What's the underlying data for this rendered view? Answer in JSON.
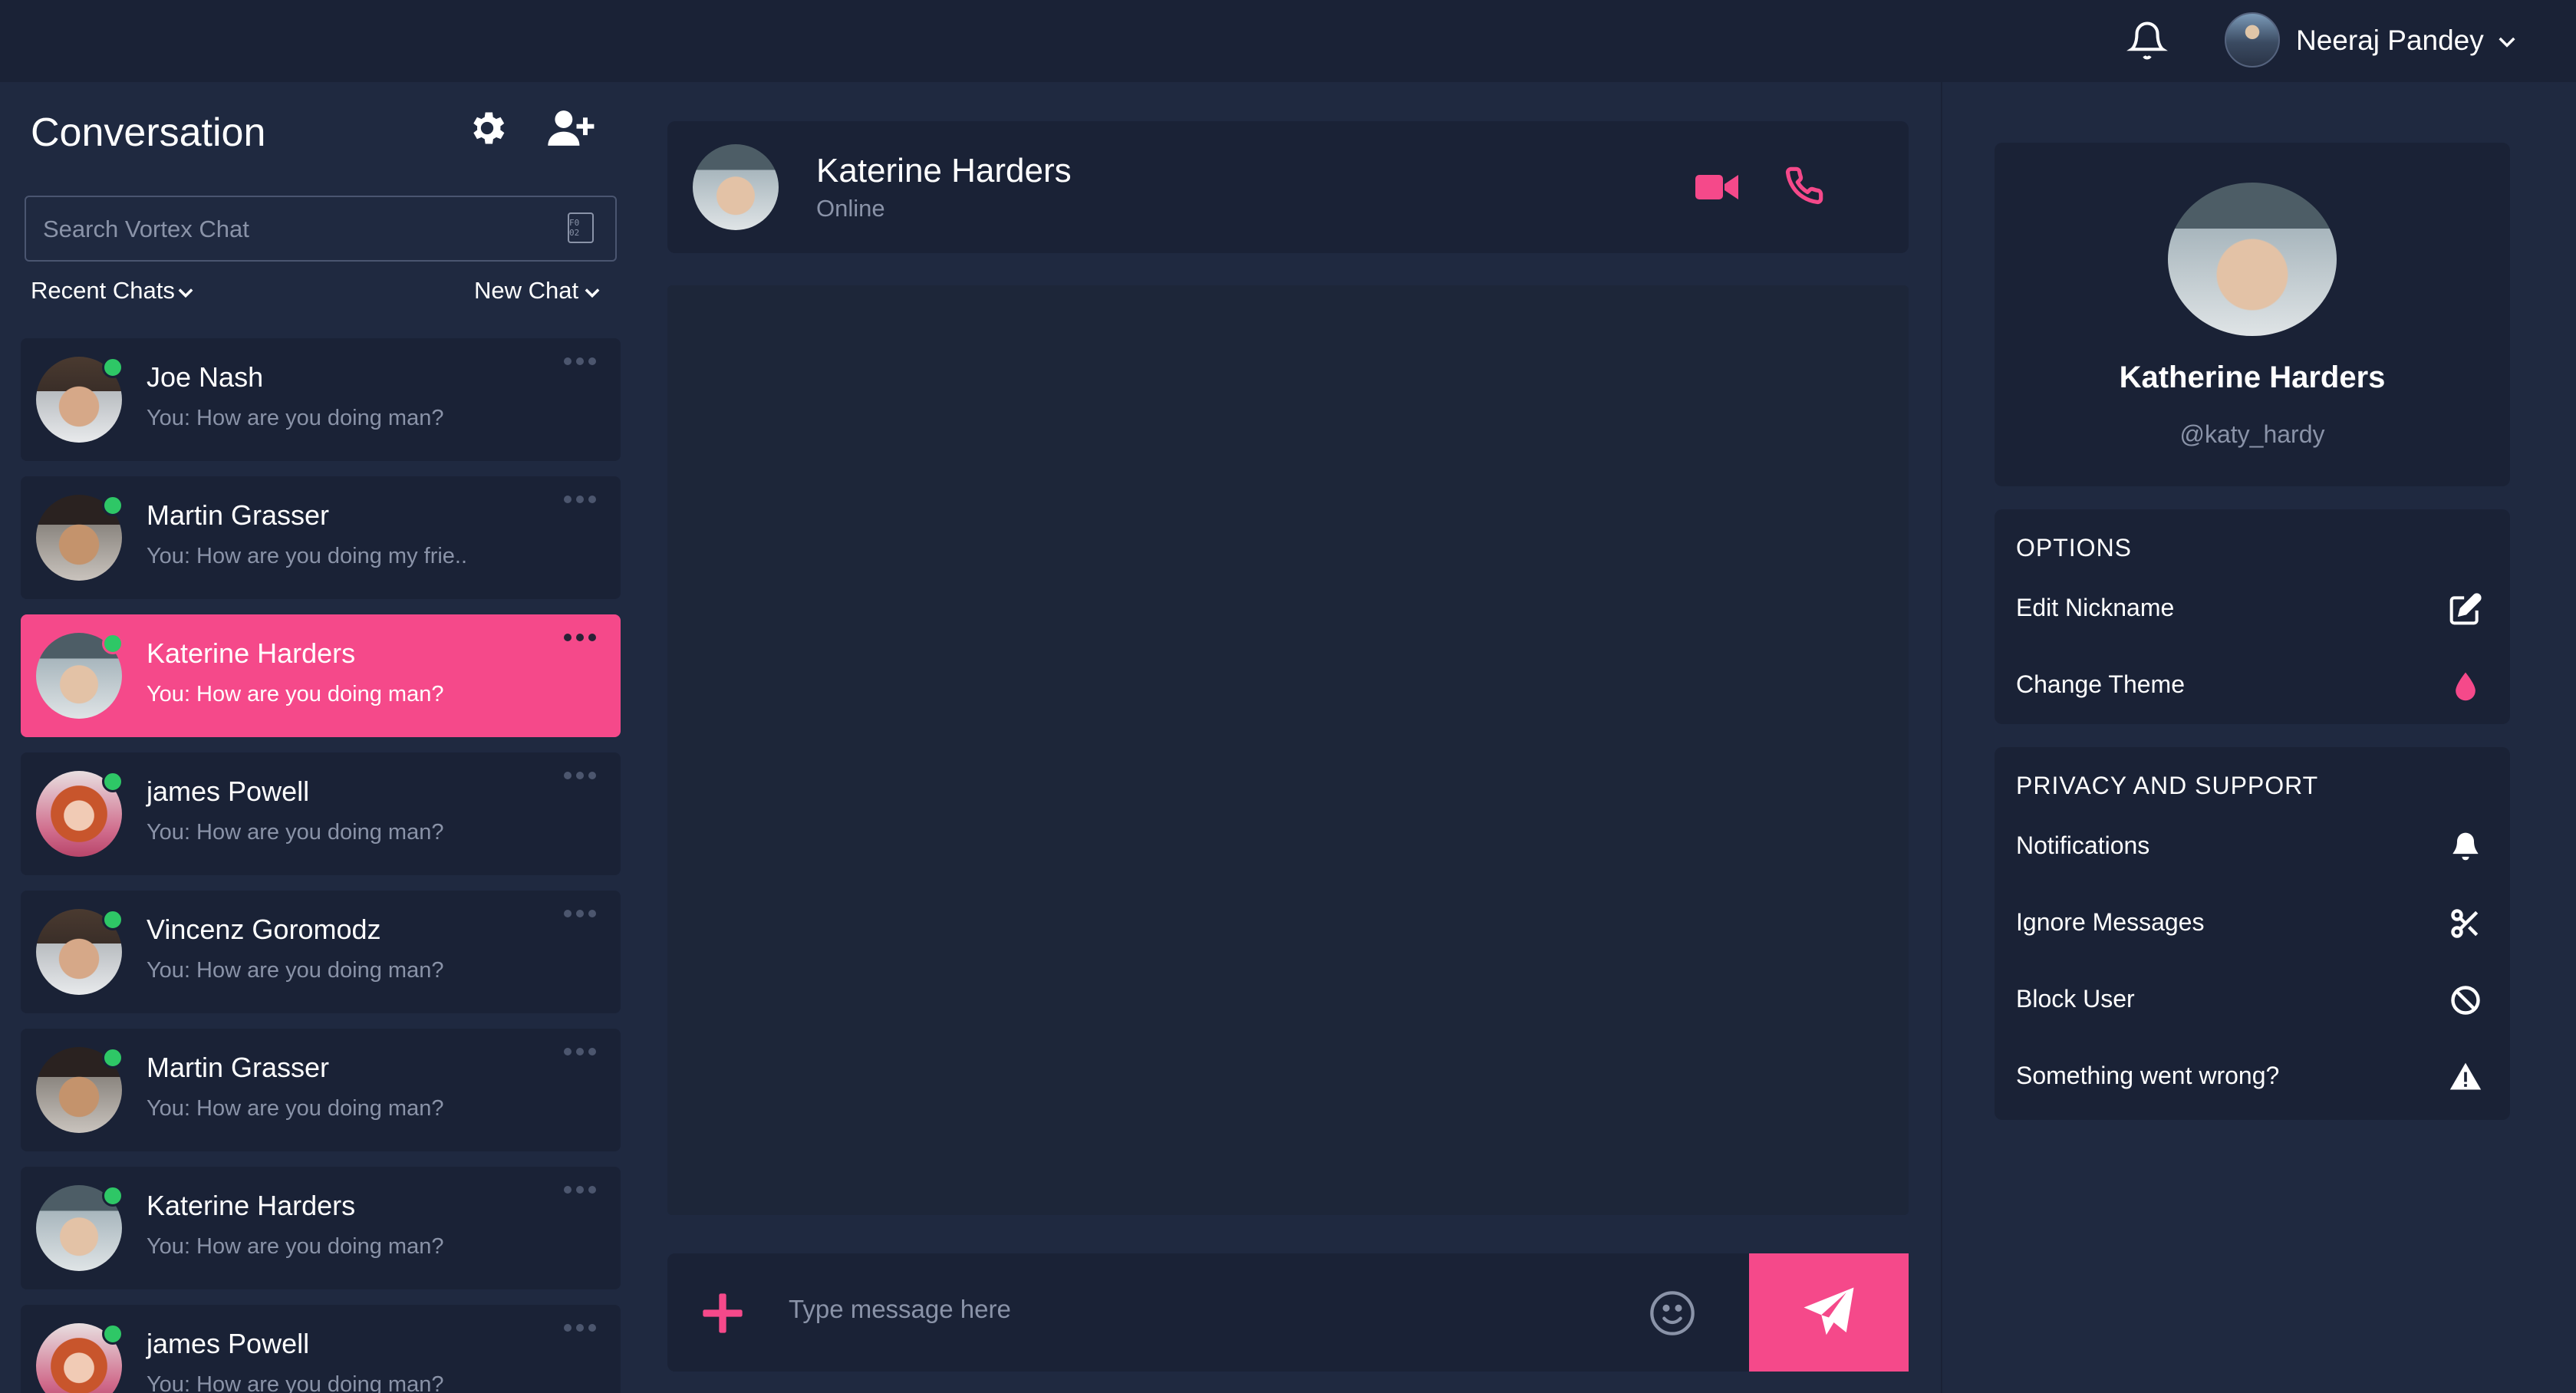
{
  "topbar": {
    "username": "Neeraj Pandey",
    "icons": [
      "bell-icon",
      "avatar",
      "chevron-down-icon"
    ]
  },
  "sidebar": {
    "title": "Conversation",
    "search_placeholder": "Search Vortex Chat",
    "search_mini_label": "F0 02",
    "recent_label": "Recent Chats",
    "new_chat_label": "New Chat",
    "chats": [
      {
        "name": "Joe Nash",
        "message": "You: How are you doing man?",
        "online": true,
        "active": false
      },
      {
        "name": "Martin Grasser",
        "message": "You: How are you doing my frie..",
        "online": true,
        "active": false
      },
      {
        "name": "Katerine Harders",
        "message": "You: How are you doing man?",
        "online": true,
        "active": true
      },
      {
        "name": "james Powell",
        "message": "You: How are you doing man?",
        "online": true,
        "active": false
      },
      {
        "name": "Vincenz Goromodz",
        "message": "You: How are you doing man?",
        "online": true,
        "active": false
      },
      {
        "name": "Martin Grasser",
        "message": "You: How are you doing man?",
        "online": true,
        "active": false
      },
      {
        "name": "Katerine Harders",
        "message": "You: How are you doing man?",
        "online": true,
        "active": false
      },
      {
        "name": "james Powell",
        "message": "You: How are you doing man?",
        "online": true,
        "active": false
      }
    ]
  },
  "chat_header": {
    "name": "Katerine Harders",
    "status": "Online"
  },
  "compose": {
    "placeholder": "Type message here"
  },
  "profile": {
    "name": "Katherine Harders",
    "handle": "@katy_hardy"
  },
  "options": {
    "title": "OPTIONS",
    "items": [
      {
        "label": "Edit Nickname",
        "icon": "edit-icon"
      },
      {
        "label": "Change Theme",
        "icon": "droplet-icon"
      }
    ]
  },
  "privacy": {
    "title": "PRIVACY AND SUPPORT",
    "items": [
      {
        "label": "Notifications",
        "icon": "bell-icon"
      },
      {
        "label": "Ignore Messages",
        "icon": "scissors-icon"
      },
      {
        "label": "Block User",
        "icon": "block-icon"
      },
      {
        "label": "Something went wrong?",
        "icon": "warning-icon"
      }
    ]
  },
  "colors": {
    "accent": "#f5498a",
    "background": "#1f2940",
    "card": "#1a2236",
    "online": "#2ec766",
    "muted_text": "#8a93a8"
  }
}
